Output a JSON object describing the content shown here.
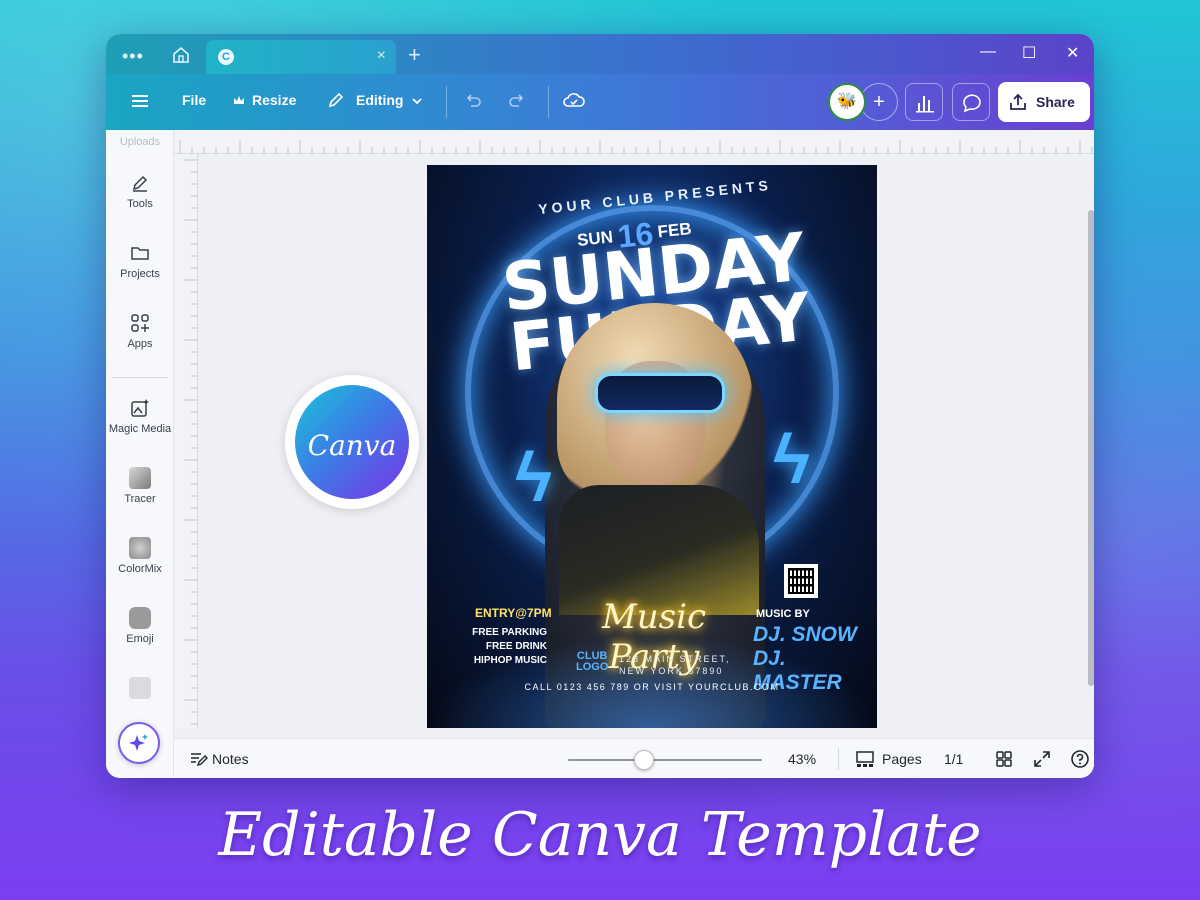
{
  "window": {
    "tab_more": "•••",
    "tab_favicon": "C",
    "tab_close": "×",
    "tab_new": "+",
    "controls": {
      "minimize": "—",
      "maximize": "☐",
      "close": "✕"
    }
  },
  "toolbar": {
    "menu_icon": "hamburger-icon",
    "file_label": "File",
    "resize_label": "Resize",
    "resize_icon": "crown-icon",
    "editing_label": "Editing",
    "share_label": "Share",
    "avatar_emoji": "🐝",
    "add_collaborator": "+"
  },
  "sidebar": {
    "items": [
      {
        "label": "Uploads",
        "icon": "upload-icon"
      },
      {
        "label": "Tools",
        "icon": "pen-icon"
      },
      {
        "label": "Projects",
        "icon": "folder-icon"
      },
      {
        "label": "Apps",
        "icon": "apps-grid-icon"
      },
      {
        "label": "Magic Media",
        "icon": "magic-image-icon"
      },
      {
        "label": "Tracer",
        "icon": "tracer-app-icon"
      },
      {
        "label": "ColorMix",
        "icon": "colormix-app-icon"
      },
      {
        "label": "Emoji",
        "icon": "emoji-app-icon"
      }
    ]
  },
  "flyer": {
    "presents": "YOUR CLUB PRESENTS",
    "date_day": "SUN",
    "date_num": "16",
    "date_month": "FEB",
    "title_line1": "SUNDAY",
    "title_line2": "FUNDAY",
    "entry": "ENTRY@7PM",
    "features": [
      "FREE PARKING",
      "FREE DRINK",
      "HIPHOP MUSIC"
    ],
    "party": "Music Party",
    "music_by": "MUSIC BY",
    "djs": [
      "DJ. SNOW",
      "DJ. MASTER"
    ],
    "logo_line1": "CLUB",
    "logo_line2": "LOGO",
    "address_line1": "123 MAIN STREET,",
    "address_line2": "NEW YORK 67890",
    "call": "CALL 0123 456 789 OR VISIT  YOURCLUB.COM"
  },
  "badge": {
    "word": "Canva"
  },
  "bottombar": {
    "notes_label": "Notes",
    "zoom": "43%",
    "zoom_fraction": 0.43,
    "pages_label": "Pages",
    "page_count": "1/1"
  },
  "caption": "Editable Canva Template",
  "colors": {
    "toolbar_start": "#1aa6c3",
    "toolbar_end": "#6a3fd2",
    "accent_blue": "#5ab3ff",
    "party_glow": "#ffd54a"
  }
}
